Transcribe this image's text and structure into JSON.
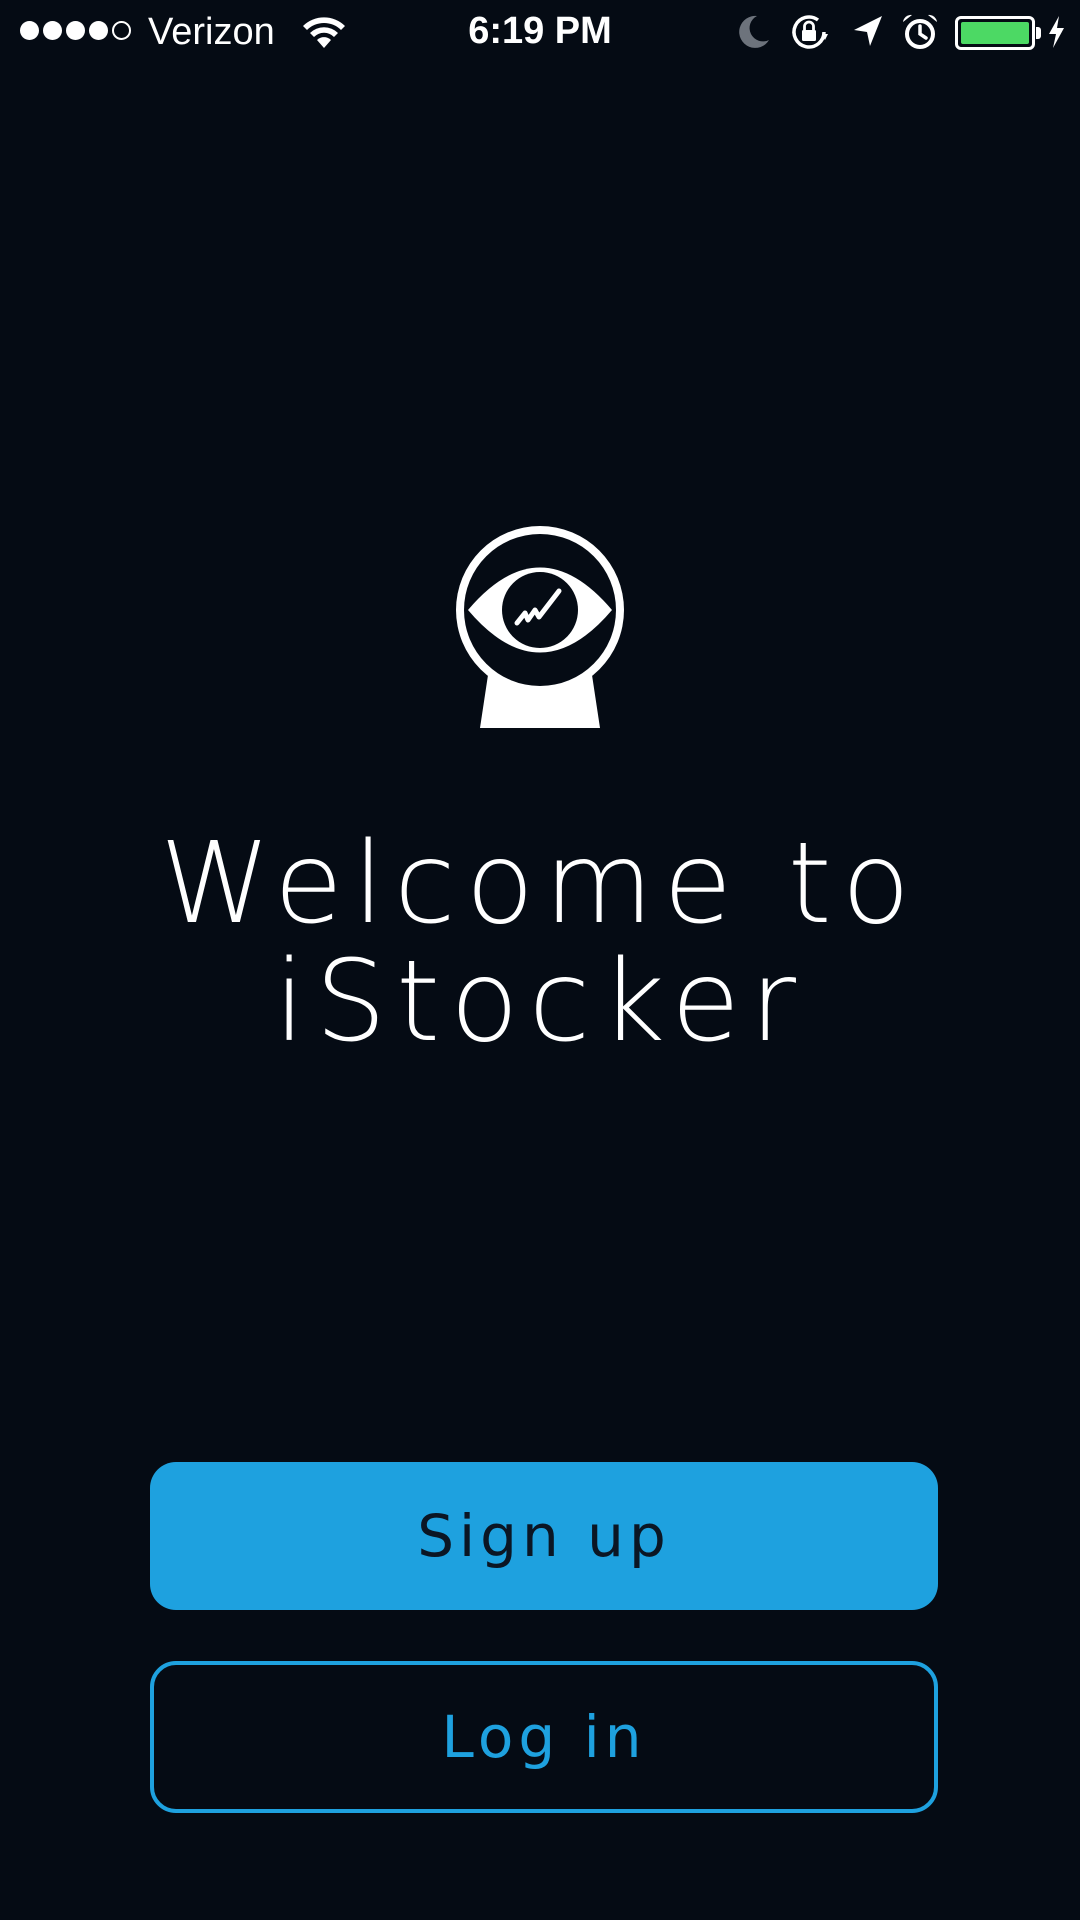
{
  "status_bar": {
    "signal_bars_filled": 4,
    "signal_bars_total": 5,
    "carrier": "Verizon",
    "time": "6:19 PM",
    "battery_level": 1.0,
    "icons": [
      "wifi-icon",
      "moon-icon",
      "rotation-lock-icon",
      "location-arrow-icon",
      "alarm-icon",
      "battery-icon",
      "charging-bolt-icon"
    ]
  },
  "logo": {
    "icon": "eye-stock-chart-icon"
  },
  "welcome": {
    "line1": "Welcome to",
    "line2": "iStocker"
  },
  "buttons": {
    "signup_label": "Sign up",
    "login_label": "Log in"
  },
  "colors": {
    "background": "#050b14",
    "accent": "#1ea1df",
    "battery": "#4cd964"
  }
}
